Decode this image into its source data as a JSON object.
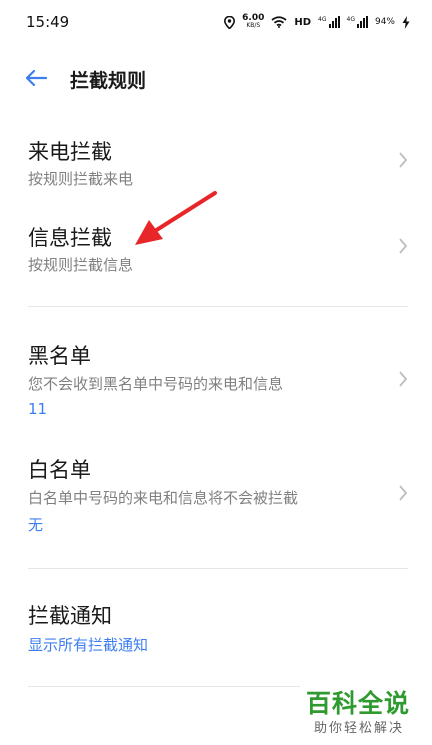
{
  "status_bar": {
    "time": "15:49",
    "net_speed": "6.00",
    "net_speed_unit": "KB/S",
    "hd_label": "HD",
    "sim1_label": "4G",
    "sim2_label": "4G",
    "battery_percent": "94%"
  },
  "header": {
    "title": "拦截规则"
  },
  "items": [
    {
      "title": "来电拦截",
      "subtitle": "按规则拦截来电"
    },
    {
      "title": "信息拦截",
      "subtitle": "按规则拦截信息"
    },
    {
      "title": "黑名单",
      "subtitle": "您不会收到黑名单中号码的来电和信息",
      "value": "11"
    },
    {
      "title": "白名单",
      "subtitle": "白名单中号码的来电和信息将不会被拦截",
      "value": "无"
    },
    {
      "title": "拦截通知",
      "link": "显示所有拦截通知"
    }
  ],
  "watermark": {
    "main": "百科全说",
    "sub": "助你轻松解决"
  },
  "colors": {
    "accent": "#3d7ff0",
    "annotation_arrow": "#e8262a",
    "watermark_green": "#2f9a2f"
  }
}
